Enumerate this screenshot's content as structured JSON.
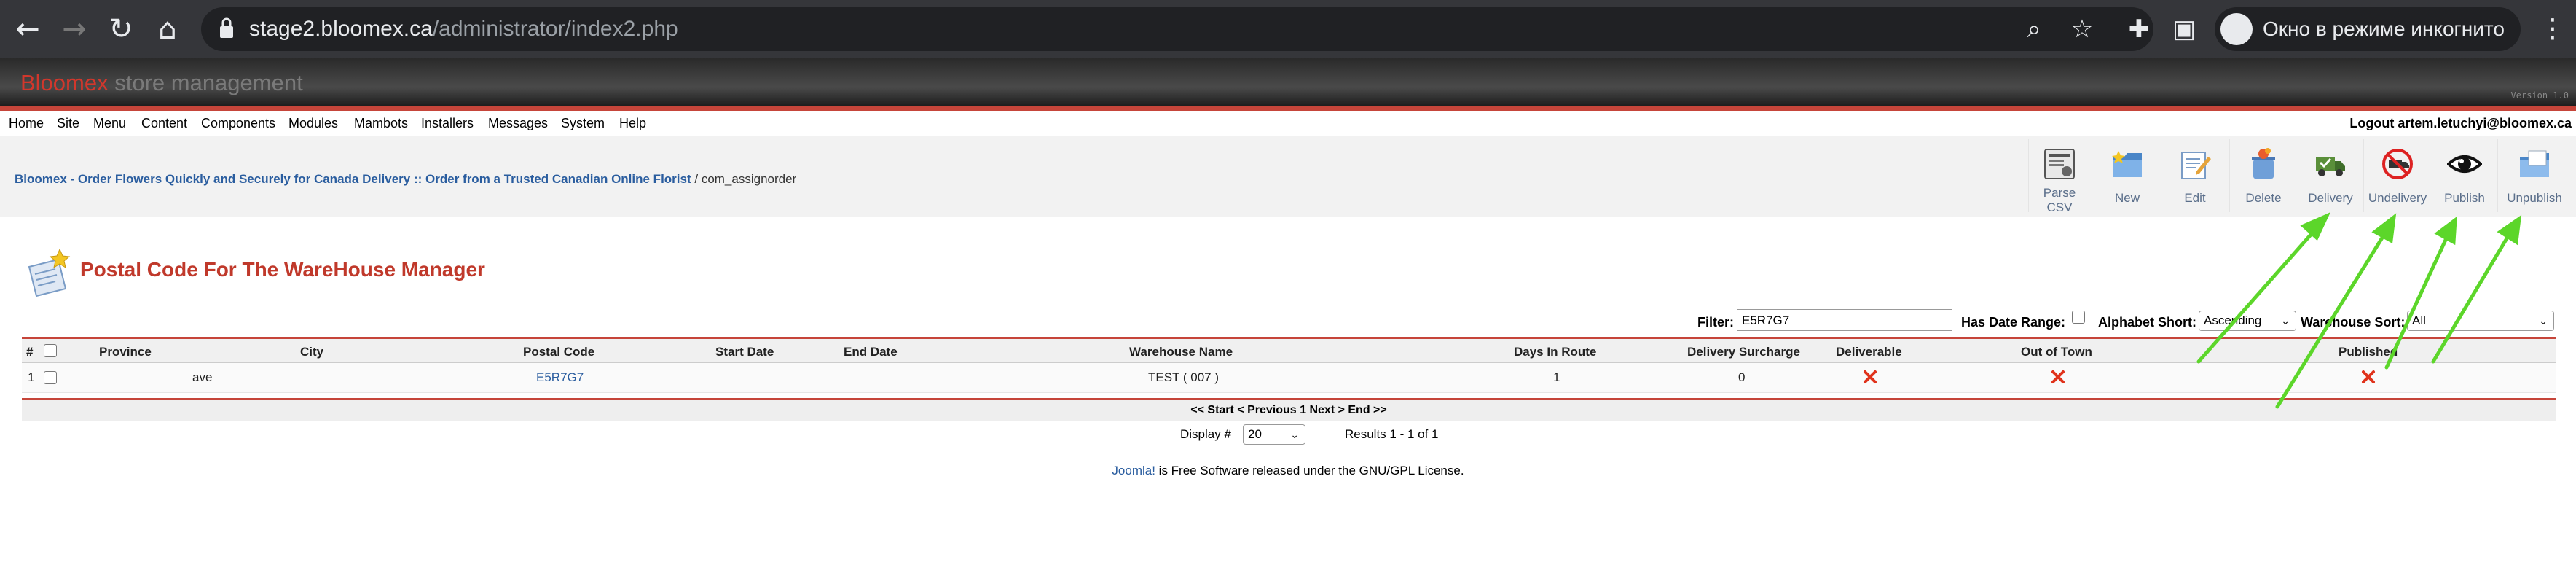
{
  "browser": {
    "url_host": "stage2.bloomex.ca",
    "url_path": "/administrator/index2.php",
    "incognito_label": "Окно в режиме инкогнито",
    "icons": [
      "back-arrow-icon",
      "forward-arrow-icon",
      "reload-icon",
      "home-icon",
      "lock-icon",
      "zoom-icon",
      "star-icon",
      "extensions-icon",
      "sidebar-icon",
      "incognito-icon",
      "kebab-menu-icon"
    ]
  },
  "header": {
    "brand_red": "Bloomex",
    "brand_gray": " store management",
    "version": "Version 1.0",
    "accent": "#c6453a"
  },
  "menu": {
    "items": [
      "Home",
      "Site",
      "Menu",
      "Content",
      "Components",
      "Modules",
      "Mambots",
      "Installers",
      "Messages",
      "System",
      "Help"
    ],
    "logout": "Logout artem.letuchyi@bloomex.ca"
  },
  "breadcrumb": {
    "link": "Bloomex - Order Flowers Quickly and Securely for Canada Delivery :: Order from a Trusted Canadian Online Florist",
    "sep": " / ",
    "current": "com_assignorder"
  },
  "toolbar": {
    "buttons": [
      {
        "label": "Parse\nCSV",
        "icon": "parse-csv-icon"
      },
      {
        "label": "New",
        "icon": "new-folder-icon"
      },
      {
        "label": "Edit",
        "icon": "edit-icon"
      },
      {
        "label": "Delete",
        "icon": "delete-icon"
      },
      {
        "label": "Delivery",
        "icon": "delivery-truck-icon"
      },
      {
        "label": "Undelivery",
        "icon": "undelivery-icon"
      },
      {
        "label": "Publish",
        "icon": "publish-eye-icon"
      },
      {
        "label": "Unpublish",
        "icon": "unpublish-folder-icon"
      }
    ]
  },
  "page": {
    "title": "Postal Code For The WareHouse Manager"
  },
  "filters": {
    "filter_label": "Filter:",
    "filter_value": "E5R7G7",
    "date_range_label": "Has Date Range:",
    "alphabet_label": "Alphabet Short:",
    "alphabet_value": "Ascending",
    "warehouse_label": "Warehouse Sort:",
    "warehouse_value": "All"
  },
  "table": {
    "columns": [
      "#",
      "Province",
      "City",
      "Postal Code",
      "Start Date",
      "End Date",
      "Warehouse Name",
      "Days In Route",
      "Delivery Surcharge",
      "Deliverable",
      "Out of Town",
      "Published"
    ],
    "rows": [
      {
        "num": "1",
        "province": "ave",
        "city": "",
        "postal_code": "E5R7G7",
        "start_date": "",
        "end_date": "",
        "warehouse": "TEST ( 007 )",
        "days": "1",
        "surcharge": "0",
        "deliverable": "no",
        "out_of_town": "no",
        "published": "no"
      }
    ],
    "pager": "<< Start < Previous 1 Next > End >>",
    "display_label": "Display #",
    "display_value": "20",
    "results": "Results 1 - 1 of 1"
  },
  "footer": {
    "link": "Joomla!",
    "text": " is Free Software released under the GNU/GPL License."
  },
  "colors": {
    "title_red": "#c0392b",
    "link_blue": "#2a5d9f",
    "annotation_green": "#5cd62a"
  }
}
